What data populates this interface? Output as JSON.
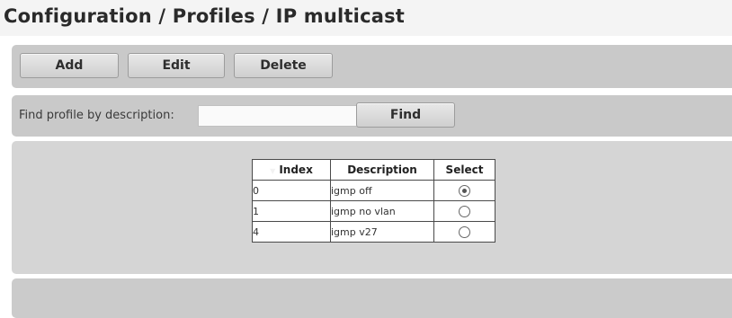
{
  "header": {
    "title": "Configuration / Profiles / IP multicast"
  },
  "toolbar": {
    "add_label": "Add",
    "edit_label": "Edit",
    "delete_label": "Delete"
  },
  "search": {
    "label": "Find profile by description:",
    "value": "",
    "placeholder": "",
    "find_label": "Find"
  },
  "table": {
    "columns": [
      "Index",
      "Description",
      "Select"
    ],
    "sorted_column": "Index",
    "rows": [
      {
        "index": "0",
        "description": "igmp off",
        "selected": true
      },
      {
        "index": "1",
        "description": "igmp no vlan",
        "selected": false
      },
      {
        "index": "4",
        "description": "igmp v27",
        "selected": false
      }
    ]
  },
  "colors": {
    "bar": "#c9c9c9",
    "panel": "#d5d5d5",
    "button": "#d8d8d8",
    "text": "#2a2a2a"
  }
}
